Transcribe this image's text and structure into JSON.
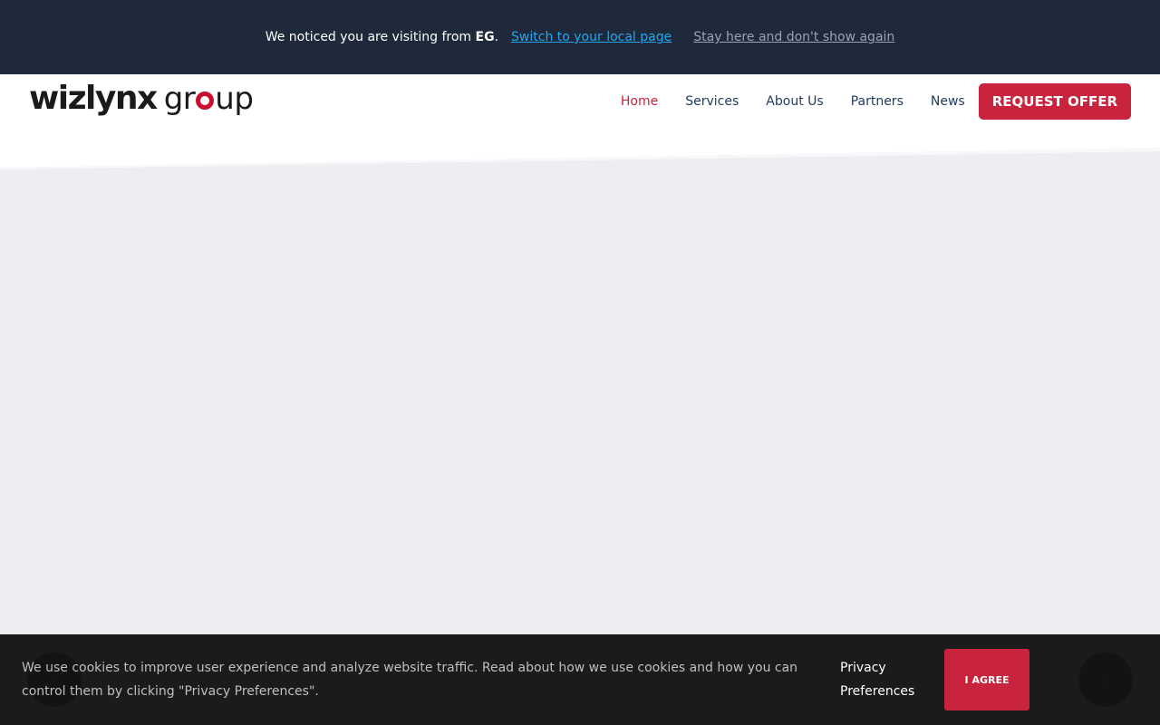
{
  "geo_banner": {
    "prefix": "We noticed you are visiting from",
    "country": "EG",
    "suffix": ".",
    "switch_link": "Switch to your local page",
    "stay_link": "Stay here and don't show again",
    "link_color": "#22a7f0"
  },
  "header": {
    "logo": {
      "part1": "wizlynx",
      "part2_before": "gr",
      "part2_after": "up",
      "accent_color": "#c8102e"
    },
    "nav": [
      {
        "label": "Home",
        "active": true
      },
      {
        "label": "Services",
        "active": false
      },
      {
        "label": "About Us",
        "active": false
      },
      {
        "label": "Partners",
        "active": false
      },
      {
        "label": "News",
        "active": false
      }
    ],
    "cta_label": "REQUEST OFFER",
    "cta_color": "#c8243d"
  },
  "slider": {
    "prev_icon": "chevron-left-icon",
    "next_icon": "chevron-right-icon"
  },
  "cookie_bar": {
    "text": "We use cookies to improve user experience and analyze website traffic. Read about how we use cookies and how you can control them by clicking \"Privacy Preferences\".",
    "privacy_link": "Privacy Preferences",
    "agree_label": "I AGREE"
  }
}
